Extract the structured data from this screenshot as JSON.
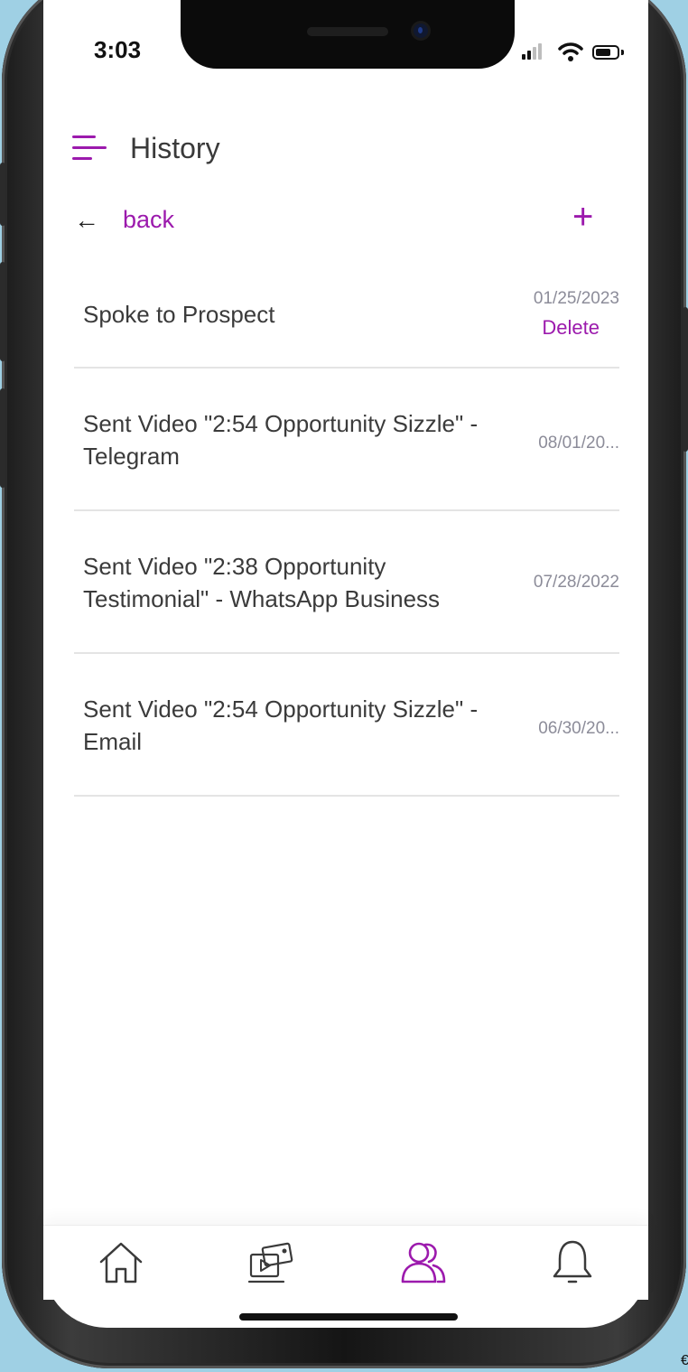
{
  "status_bar": {
    "time": "3:03"
  },
  "header": {
    "title": "History"
  },
  "nav": {
    "back_label": "back",
    "add_label": "+"
  },
  "history": [
    {
      "text": "Spoke to Prospect",
      "date": "01/25/2023",
      "action": "Delete"
    },
    {
      "text": "Sent Video \"2:54 Opportunity Sizzle\" - Telegram",
      "date": "08/01/20..."
    },
    {
      "text": "Sent Video \"2:38 Opportunity Testimonial\" - WhatsApp Business",
      "date": "07/28/2022"
    },
    {
      "text": "Sent Video \"2:54 Opportunity Sizzle\" - Email",
      "date": "06/30/20..."
    }
  ],
  "tabbar": {
    "tabs": [
      {
        "icon": "home-icon",
        "active": false
      },
      {
        "icon": "media-icon",
        "active": false
      },
      {
        "icon": "contacts-icon",
        "active": true
      },
      {
        "icon": "bell-icon",
        "active": false
      }
    ]
  },
  "colors": {
    "accent": "#9c1aad",
    "text_primary": "#3b3b3b",
    "text_secondary": "#8c8c99",
    "divider": "#e4e4e4",
    "icon_inactive": "#3a3a3a"
  },
  "corner_mark": "€"
}
